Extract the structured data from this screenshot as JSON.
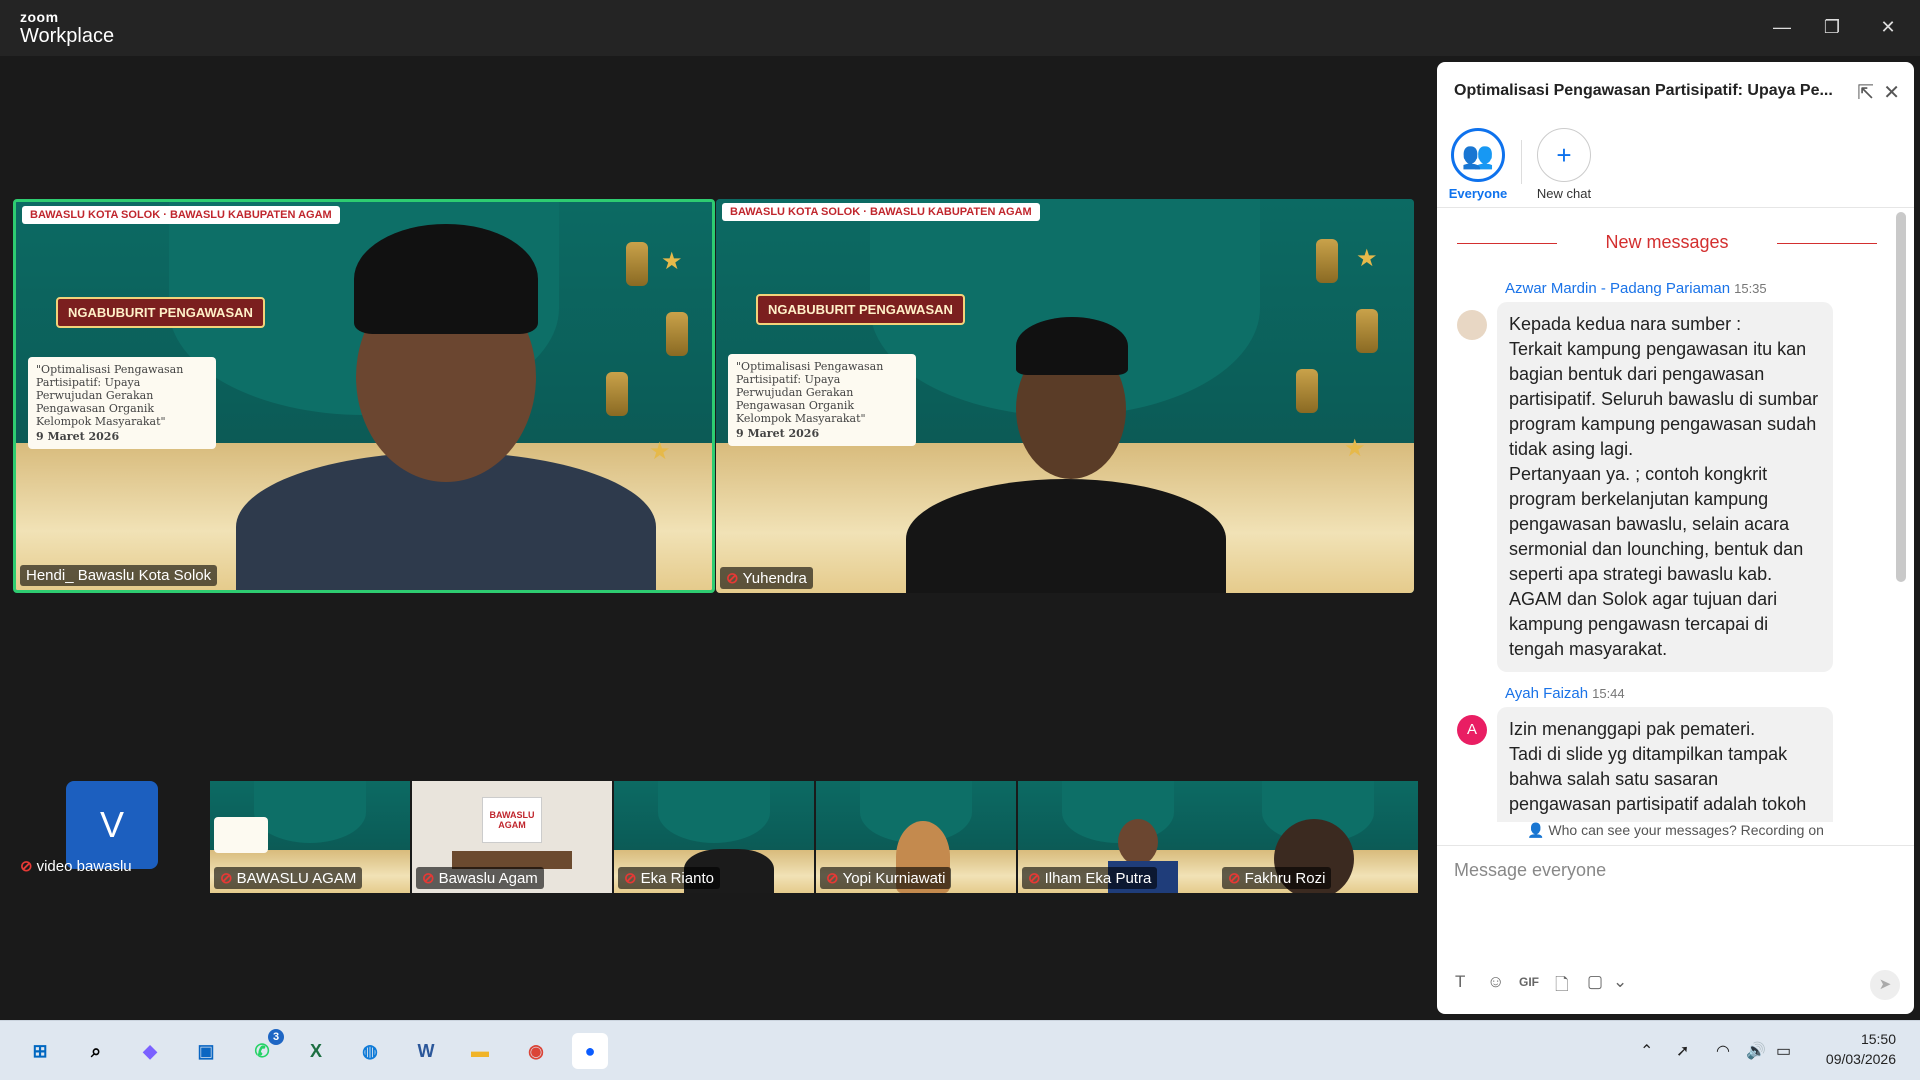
{
  "app": {
    "brand_small": "zoom",
    "brand_big": "Workplace"
  },
  "window": {
    "minimize": "—",
    "restore": "❐",
    "close": "✕"
  },
  "main_tiles": [
    {
      "name": "Hendi_ Bawaslu Kota Solok",
      "muted": false,
      "active": true
    },
    {
      "name": "Yuhendra",
      "muted": true,
      "active": false
    }
  ],
  "poster": {
    "logos": "BAWASLU KOTA SOLOK · BAWASLU KABUPATEN AGAM",
    "badge": "NGABUBURIT PENGAWASAN",
    "text": "\"Optimalisasi Pengawasan Partisipatif: Upaya Perwujudan Gerakan Pengawasan Organik Kelompok Masyarakat\"",
    "date": "9 Maret 2026"
  },
  "gallery": [
    {
      "name": "video bawaslu",
      "avatar": "V"
    },
    {
      "name": "BAWASLU AGAM"
    },
    {
      "name": "Bawaslu Agam",
      "sign": "BAWASLU AGAM"
    },
    {
      "name": "Eka Rianto"
    },
    {
      "name": "Yopi Kurniawati"
    },
    {
      "name": "Ilham Eka Putra"
    },
    {
      "name": "Fakhru Rozi"
    }
  ],
  "chat": {
    "title": "Optimalisasi Pengawasan Partisipatif: Upaya Pe...",
    "chips": [
      {
        "label": "Everyone",
        "icon": "people-icon",
        "selected": true
      },
      {
        "label": "New chat",
        "icon": "plus-icon",
        "selected": false
      }
    ],
    "new_messages": "New messages",
    "messages": [
      {
        "sender": "Azwar Mardin - Padang Pariaman",
        "time": "15:35",
        "text": "Kepada kedua nara sumber :\nTerkait kampung pengawasan itu kan bagian bentuk dari pengawasan partisipatif. Seluruh bawaslu di sumbar program kampung pengawasan sudah tidak asing lagi.\nPertanyaan ya. ; contoh kongkrit program berkelanjutan kampung pengawasan bawaslu, selain acara sermonial dan lounching, bentuk dan seperti apa strategi bawaslu kab. AGAM dan Solok agar tujuan dari kampung pengawasn tercapai di tengah masyarakat."
      },
      {
        "sender": "Ayah Faizah",
        "time": "15:44",
        "avatar": "A",
        "text": "Izin menanggapi pak pemateri.\nTadi di slide yg ditampilkan tampak bahwa salah satu sasaran pengawasan partisipatif adalah tokoh agama"
      }
    ],
    "notice": "Who can see your messages? Recording on",
    "input_placeholder": "Message everyone",
    "tools": [
      "T",
      "☺",
      "GIF",
      "🗋",
      "▢",
      "⌄"
    ],
    "send": "➤"
  },
  "taskbar": {
    "apps": [
      "start-icon",
      "search-icon",
      "copilot-icon",
      "store-icon",
      "whatsapp-icon",
      "excel-icon",
      "edge-icon",
      "word-icon",
      "explorer-icon",
      "chrome-icon",
      "zoom-icon"
    ],
    "whatsapp_badge": "3",
    "time": "15:50",
    "date": "09/03/2026"
  },
  "colors": {
    "active_border": "#2ecc71",
    "accent": "#0e72ed",
    "new_messages": "#d32f2f"
  }
}
